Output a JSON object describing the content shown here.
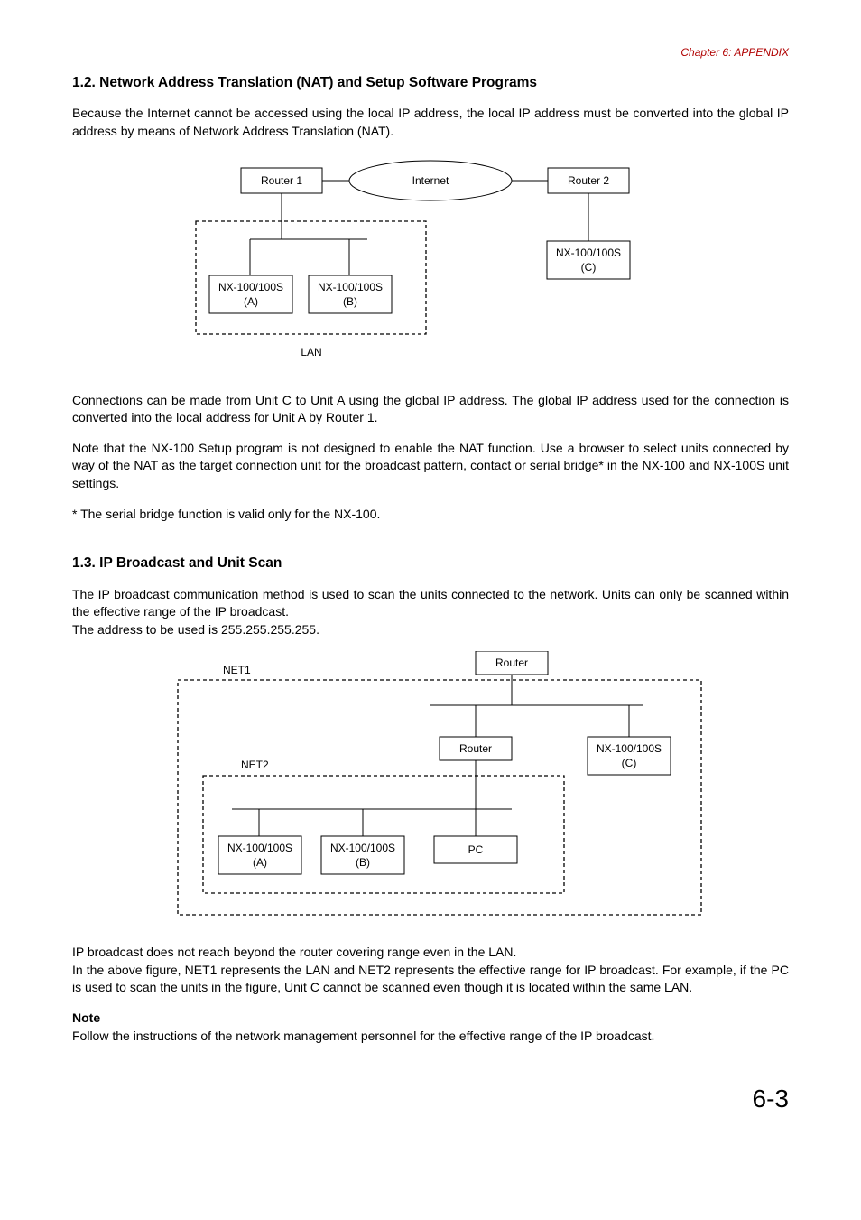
{
  "header": {
    "chapter": "Chapter 6:  APPENDIX"
  },
  "section12": {
    "heading": "1.2. Network Address Translation (NAT) and Setup Software Programs",
    "p1": "Because the Internet cannot be accessed using the local IP address, the local IP address must be converted into the global IP address by means of Network Address Translation (NAT).",
    "p2": "Connections can be made from Unit C to Unit A using the global IP address. The global IP address used for the connection is converted into the local address for Unit A by Router 1.",
    "p3": "Note that the NX-100 Setup program is not designed to enable the NAT function. Use a browser to select units connected by way of the NAT as the target connection unit for the broadcast pattern, contact or serial bridge* in the NX-100 and NX-100S unit settings.",
    "p4": "* The serial bridge function is valid only for the NX-100."
  },
  "diagram1": {
    "router1": "Router 1",
    "internet": "Internet",
    "router2": "Router 2",
    "nxA1": "NX-100/100S",
    "nxA2": "(A)",
    "nxB1": "NX-100/100S",
    "nxB2": "(B)",
    "nxC1": "NX-100/100S",
    "nxC2": "(C)",
    "lan": "LAN"
  },
  "section13": {
    "heading": "1.3. IP Broadcast and Unit Scan",
    "p1": "The IP broadcast communication method is used to scan the units connected to the network. Units can only be scanned within the effective range of the IP broadcast.",
    "p1b": "The address to be used is 255.255.255.255.",
    "p2a": "IP broadcast does not reach beyond the router covering range even in the LAN.",
    "p2b": "In the above figure, NET1 represents the LAN and NET2 represents the effective range for IP broadcast. For example, if the PC is used to scan the units in the figure, Unit C cannot be scanned even though it is located within the same LAN.",
    "note": "Note",
    "noteText": "Follow the instructions of the network management personnel for the effective range of the IP broadcast."
  },
  "diagram2": {
    "routerTop": "Router",
    "routerMid": "Router",
    "net1": "NET1",
    "net2": "NET2",
    "nxA1": "NX-100/100S",
    "nxA2": "(A)",
    "nxB1": "NX-100/100S",
    "nxB2": "(B)",
    "nxC1": "NX-100/100S",
    "nxC2": "(C)",
    "pc": "PC"
  },
  "pageNumber": "6-3"
}
